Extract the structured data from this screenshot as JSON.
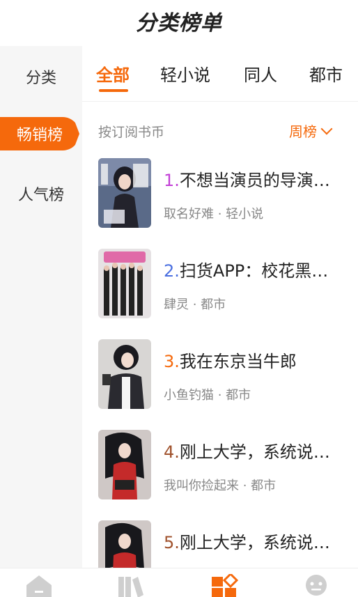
{
  "header": {
    "title": "分类榜单"
  },
  "sidebar": {
    "items": [
      {
        "label": "分类"
      },
      {
        "label": "畅销榜"
      },
      {
        "label": "人气榜"
      }
    ]
  },
  "tabs": [
    {
      "label": "全部"
    },
    {
      "label": "轻小说"
    },
    {
      "label": "同人"
    },
    {
      "label": "都市"
    }
  ],
  "list_header": {
    "sort_label": "按订阅书币",
    "period": "周榜"
  },
  "books": [
    {
      "rank": "1.",
      "rank_color": "#c23fd6",
      "title": "不想当演员的导演不是好男神",
      "author": "取名好难",
      "category": "轻小说"
    },
    {
      "rank": "2.",
      "rank_color": "#4a6fe0",
      "title": "扫货APP：校花黑丝女主播",
      "author": "肆灵",
      "category": "都市"
    },
    {
      "rank": "3.",
      "rank_color": "#f5690c",
      "title": "我在东京当牛郎",
      "author": "小鱼钓猫",
      "category": "都市"
    },
    {
      "rank": "4.",
      "rank_color": "#a0522d",
      "title": "刚上大学，系统说我是富二代",
      "author": "我叫你捡起来",
      "category": "都市"
    },
    {
      "rank": "5.",
      "rank_color": "#a0522d",
      "title": "刚上大学，系统说我是富二代",
      "author": "",
      "category": ""
    }
  ],
  "meta_separator": " · ",
  "colors": {
    "accent": "#f5690c",
    "sidebar_bg": "#f6f6f6"
  },
  "bottom_nav": [
    {
      "icon": "home-icon"
    },
    {
      "icon": "bookshelf-icon"
    },
    {
      "icon": "category-icon",
      "active": true
    },
    {
      "icon": "profile-icon"
    }
  ]
}
